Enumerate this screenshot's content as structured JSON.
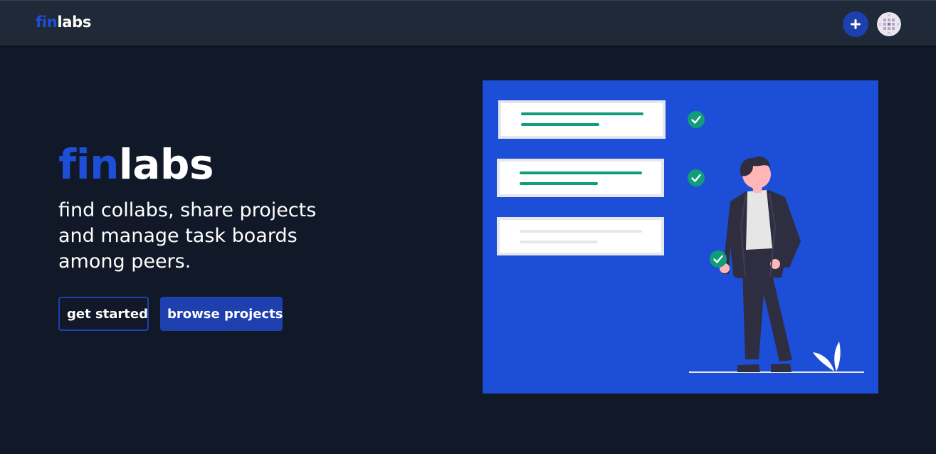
{
  "navbar": {
    "logo": {
      "part1": "fin",
      "part2": "labs"
    },
    "add_icon": "plus-icon",
    "avatar_icon": "user-avatar"
  },
  "hero": {
    "title": {
      "part1": "fin",
      "part2": "labs"
    },
    "subtitle": "find collabs, share projects and manage task boards among peers.",
    "get_started_label": "get started",
    "browse_projects_label": "browse projects"
  },
  "illustration": {
    "icons": [
      "task-card",
      "check-icon",
      "person-figure",
      "plant-leaf"
    ],
    "tasks_completed": [
      true,
      true,
      false
    ]
  },
  "colors": {
    "background": "#111827",
    "navbar": "#1f2937",
    "accent": "#1e40af",
    "brand_blue": "#1d4ed8",
    "task_line": "#0f9d7a",
    "check": "#0f9d7a"
  }
}
